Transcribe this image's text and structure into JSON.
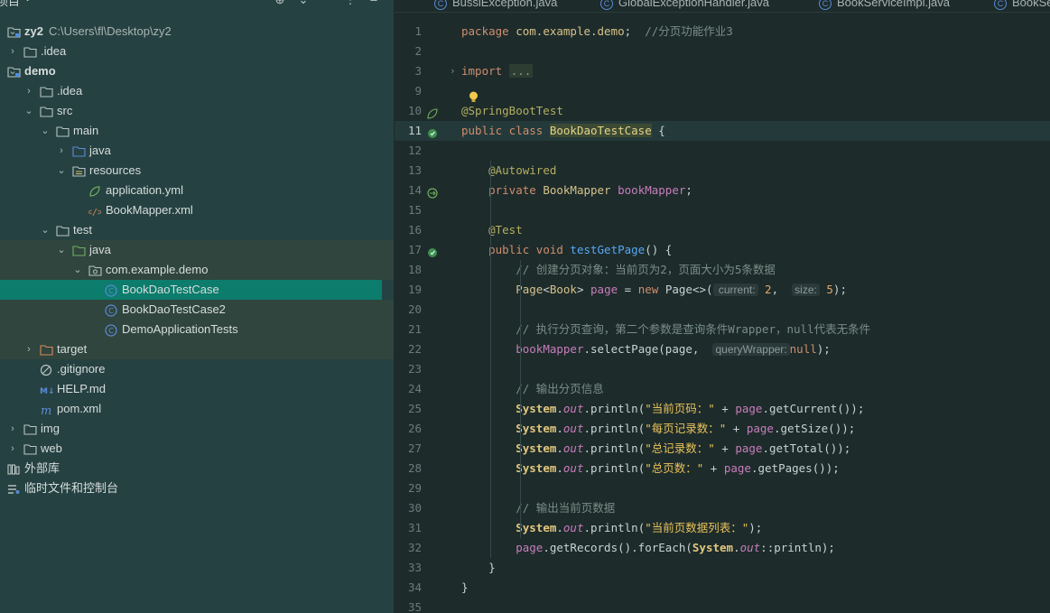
{
  "project_panel": {
    "title": "项目",
    "title_chevron_icon": "chevron-down-icon",
    "header_buttons": [
      "target-icon",
      "expand-icon",
      "collapse-icon",
      "more-icon",
      "minimize-icon"
    ],
    "tree": [
      {
        "id": "zy2",
        "label": "zy2",
        "path": "C:\\Users\\fl\\Desktop\\zy2",
        "expanded": true,
        "icon": "module-folder-icon"
      },
      {
        "id": "idea-root",
        "label": ".idea",
        "expanded": false,
        "icon": "folder-icon"
      },
      {
        "id": "demo",
        "label": "demo",
        "expanded": true,
        "icon": "module-folder-icon"
      },
      {
        "id": "idea-demo",
        "label": ".idea",
        "expanded": false,
        "icon": "folder-icon"
      },
      {
        "id": "src",
        "label": "src",
        "expanded": true,
        "icon": "folder-icon"
      },
      {
        "id": "main",
        "label": "main",
        "expanded": true,
        "icon": "folder-icon"
      },
      {
        "id": "java-main",
        "label": "java",
        "expanded": false,
        "icon": "source-folder-icon"
      },
      {
        "id": "resources",
        "label": "resources",
        "expanded": true,
        "icon": "resources-folder-icon"
      },
      {
        "id": "application-yml",
        "label": "application.yml",
        "icon": "spring-config-icon"
      },
      {
        "id": "bookmapper-xml",
        "label": "BookMapper.xml",
        "icon": "xml-file-icon"
      },
      {
        "id": "test",
        "label": "test",
        "expanded": true,
        "icon": "folder-icon"
      },
      {
        "id": "java-test",
        "label": "java",
        "expanded": true,
        "icon": "test-source-folder-icon"
      },
      {
        "id": "package",
        "label": "com.example.demo",
        "expanded": true,
        "icon": "package-icon"
      },
      {
        "id": "bookdaotestcase",
        "label": "BookDaoTestCase",
        "icon": "java-class-icon"
      },
      {
        "id": "bookdaotestcase2",
        "label": "BookDaoTestCase2",
        "icon": "java-class-icon"
      },
      {
        "id": "demoapplicationtests",
        "label": "DemoApplicationTests",
        "icon": "java-class-icon"
      },
      {
        "id": "target",
        "label": "target",
        "expanded": false,
        "icon": "excluded-folder-icon"
      },
      {
        "id": "gitignore",
        "label": ".gitignore",
        "icon": "ignore-file-icon"
      },
      {
        "id": "help-md",
        "label": "HELP.md",
        "icon": "markdown-icon"
      },
      {
        "id": "pom-xml",
        "label": "pom.xml",
        "icon": "maven-icon"
      },
      {
        "id": "img",
        "label": "img",
        "expanded": false,
        "icon": "folder-icon"
      },
      {
        "id": "web",
        "label": "web",
        "expanded": false,
        "icon": "folder-icon"
      },
      {
        "id": "external-libs",
        "label": "外部库",
        "icon": "library-icon"
      },
      {
        "id": "scratches",
        "label": "临时文件和控制台",
        "icon": "scratches-icon"
      }
    ]
  },
  "editor": {
    "tabs": [
      {
        "label": "BussiException.java",
        "icon": "java-class-icon"
      },
      {
        "label": "GlobalExceptionHandler.java",
        "icon": "java-class-icon"
      },
      {
        "label": "BookServiceImpl.java",
        "icon": "java-class-icon"
      },
      {
        "label": "BookSe",
        "icon": "java-class-icon"
      }
    ],
    "lines": [
      {
        "n": "1",
        "parts": [
          [
            "kw",
            "package "
          ],
          [
            "cls",
            "com.example.demo"
          ],
          [
            "",
            "; "
          ],
          [
            "cmt",
            " //分页功能作业3"
          ]
        ]
      },
      {
        "n": "2",
        "parts": []
      },
      {
        "n": "3",
        "fold": "›",
        "parts": [
          [
            "kw",
            "import "
          ],
          [
            "fold-box",
            "..."
          ]
        ]
      },
      {
        "n": "9",
        "parts": []
      },
      {
        "n": "10",
        "gutter": "spring-bean-icon",
        "parts": [
          [
            "ann",
            "@SpringBootTest"
          ]
        ]
      },
      {
        "n": "11",
        "gutter": "run-test-icon",
        "current": true,
        "parts": [
          [
            "kw",
            "public class "
          ],
          [
            "clsh",
            "BookDaoTestCase"
          ],
          [
            "",
            " {"
          ]
        ]
      },
      {
        "n": "12",
        "parts": []
      },
      {
        "n": "13",
        "parts": [
          [
            "",
            "    "
          ],
          [
            "ann",
            "@Autowired"
          ]
        ]
      },
      {
        "n": "14",
        "gutter": "autowired-icon",
        "parts": [
          [
            "",
            "    "
          ],
          [
            "kw",
            "private "
          ],
          [
            "cls",
            "BookMapper "
          ],
          [
            "fld",
            "bookMapper"
          ],
          [
            "",
            ";"
          ]
        ]
      },
      {
        "n": "15",
        "parts": []
      },
      {
        "n": "16",
        "parts": [
          [
            "",
            "    "
          ],
          [
            "ann",
            "@Test"
          ]
        ]
      },
      {
        "n": "17",
        "gutter": "run-test-icon",
        "parts": [
          [
            "",
            "    "
          ],
          [
            "kw",
            "public void "
          ],
          [
            "fn",
            "testGetPage"
          ],
          [
            "",
            "() {"
          ]
        ]
      },
      {
        "n": "18",
        "parts": [
          [
            "",
            "        "
          ],
          [
            "cmt",
            "// 创建分页对象：当前页为2，页面大小为5条数据"
          ]
        ]
      },
      {
        "n": "19",
        "parts": [
          [
            "",
            "        "
          ],
          [
            "cls",
            "Page"
          ],
          [
            "",
            "<"
          ],
          [
            "cls",
            "Book"
          ],
          [
            "",
            "> "
          ],
          [
            "fld",
            "page"
          ],
          [
            "",
            " = "
          ],
          [
            "kw",
            "new "
          ],
          [
            "",
            "Page<>("
          ],
          [
            "hint",
            " current:"
          ],
          [
            "num",
            " 2"
          ],
          [
            "",
            ",  "
          ],
          [
            "hint",
            "size:"
          ],
          [
            "num",
            " 5"
          ],
          [
            "",
            ");"
          ]
        ]
      },
      {
        "n": "20",
        "parts": []
      },
      {
        "n": "21",
        "parts": [
          [
            "",
            "        "
          ],
          [
            "cmt",
            "// 执行分页查询，第二个参数是查询条件Wrapper，null代表无条件"
          ]
        ]
      },
      {
        "n": "22",
        "parts": [
          [
            "",
            "        "
          ],
          [
            "fld",
            "bookMapper"
          ],
          [
            "",
            ".selectPage(page,  "
          ],
          [
            "hint",
            "queryWrapper:"
          ],
          [
            "kw",
            "null"
          ],
          [
            "",
            ");"
          ]
        ]
      },
      {
        "n": "23",
        "parts": []
      },
      {
        "n": "24",
        "parts": [
          [
            "",
            "        "
          ],
          [
            "cmt",
            "// 输出分页信息"
          ]
        ]
      },
      {
        "n": "25",
        "parts": [
          [
            "",
            "        "
          ],
          [
            "sys",
            "System"
          ],
          [
            "",
            "."
          ],
          [
            "out",
            "out"
          ],
          [
            "",
            ".println("
          ],
          [
            "str",
            "\"当前页码：\""
          ],
          [
            "",
            " + "
          ],
          [
            "fld",
            "page"
          ],
          [
            "",
            ".getCurrent());"
          ]
        ]
      },
      {
        "n": "26",
        "parts": [
          [
            "",
            "        "
          ],
          [
            "sys",
            "System"
          ],
          [
            "",
            "."
          ],
          [
            "out",
            "out"
          ],
          [
            "",
            ".println("
          ],
          [
            "str",
            "\"每页记录数：\""
          ],
          [
            "",
            " + "
          ],
          [
            "fld",
            "page"
          ],
          [
            "",
            ".getSize());"
          ]
        ]
      },
      {
        "n": "27",
        "parts": [
          [
            "",
            "        "
          ],
          [
            "sys",
            "System"
          ],
          [
            "",
            "."
          ],
          [
            "out",
            "out"
          ],
          [
            "",
            ".println("
          ],
          [
            "str",
            "\"总记录数：\""
          ],
          [
            "",
            " + "
          ],
          [
            "fld",
            "page"
          ],
          [
            "",
            ".getTotal());"
          ]
        ]
      },
      {
        "n": "28",
        "parts": [
          [
            "",
            "        "
          ],
          [
            "sys",
            "System"
          ],
          [
            "",
            "."
          ],
          [
            "out",
            "out"
          ],
          [
            "",
            ".println("
          ],
          [
            "str",
            "\"总页数：\""
          ],
          [
            "",
            " + "
          ],
          [
            "fld",
            "page"
          ],
          [
            "",
            ".getPages());"
          ]
        ]
      },
      {
        "n": "29",
        "parts": []
      },
      {
        "n": "30",
        "parts": [
          [
            "",
            "        "
          ],
          [
            "cmt",
            "// 输出当前页数据"
          ]
        ]
      },
      {
        "n": "31",
        "parts": [
          [
            "",
            "        "
          ],
          [
            "sys",
            "System"
          ],
          [
            "",
            "."
          ],
          [
            "out",
            "out"
          ],
          [
            "",
            ".println("
          ],
          [
            "str",
            "\"当前页数据列表：\""
          ],
          [
            "",
            ");"
          ]
        ]
      },
      {
        "n": "32",
        "parts": [
          [
            "",
            "        "
          ],
          [
            "fld",
            "page"
          ],
          [
            "",
            ".getRecords().forEach("
          ],
          [
            "sys",
            "System"
          ],
          [
            "",
            "."
          ],
          [
            "out",
            "out"
          ],
          [
            "",
            "::println);"
          ]
        ]
      },
      {
        "n": "33",
        "parts": [
          [
            "",
            "    }"
          ]
        ]
      },
      {
        "n": "34",
        "parts": [
          [
            "",
            "}"
          ]
        ]
      },
      {
        "n": "35",
        "parts": []
      }
    ]
  },
  "colors": {
    "selection": "#0c7c6c",
    "editor_bg": "#1d2b2b",
    "panel_bg": "#264141"
  }
}
